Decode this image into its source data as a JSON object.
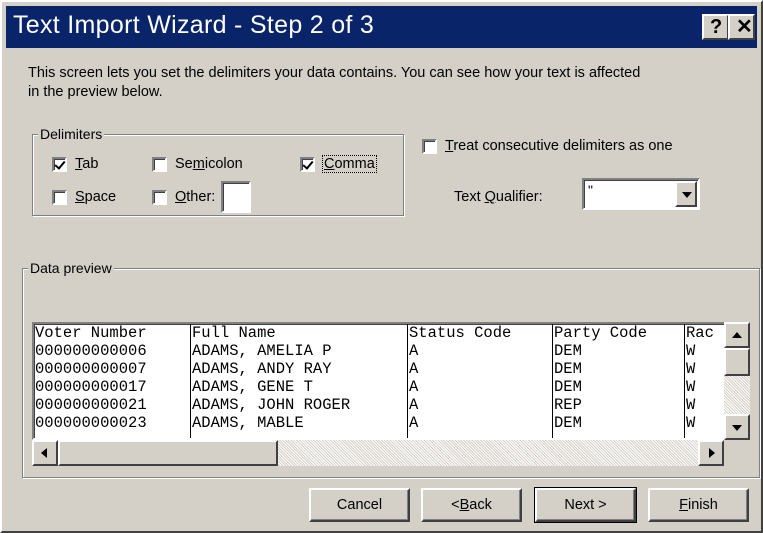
{
  "window": {
    "title": "Text Import Wizard - Step 2 of 3",
    "help_button": "?",
    "close_button": "✕"
  },
  "intro_text": "This screen lets you set the delimiters your data contains.  You can see how your text is affected in the preview below.",
  "delimiters": {
    "group_label": "Delimiters",
    "tab": {
      "pre": "",
      "key": "T",
      "post": "ab",
      "checked": true
    },
    "semicolon": {
      "pre": "Se",
      "key": "m",
      "post": "icolon",
      "checked": false
    },
    "comma": {
      "pre": "",
      "key": "C",
      "post": "omma",
      "checked": true
    },
    "space": {
      "pre": "",
      "key": "S",
      "post": "pace",
      "checked": false
    },
    "other": {
      "pre": "",
      "key": "O",
      "post": "ther:",
      "checked": false,
      "value": ""
    }
  },
  "consecutive": {
    "pre": "",
    "key": "T",
    "post": "reat consecutive delimiters as one",
    "checked": false
  },
  "text_qualifier": {
    "pre": "Text ",
    "key": "Q",
    "post": "ualifier:",
    "value": "\""
  },
  "preview": {
    "group_label": "Data preview",
    "columns": [
      {
        "header": "Voter Number",
        "rows": [
          "000000000006",
          "000000000007",
          "000000000017",
          "000000000021",
          "000000000023"
        ]
      },
      {
        "header": "Full Name",
        "rows": [
          "ADAMS, AMELIA P",
          "ADAMS, ANDY RAY",
          "ADAMS, GENE T",
          "ADAMS, JOHN ROGER",
          "ADAMS, MABLE"
        ]
      },
      {
        "header": "Status Code",
        "rows": [
          "A",
          "A",
          "A",
          "A",
          "A"
        ]
      },
      {
        "header": "Party Code",
        "rows": [
          "DEM",
          "DEM",
          "DEM",
          "REP",
          "DEM"
        ]
      },
      {
        "header": "Rac",
        "rows": [
          "W",
          "W",
          "W",
          "W",
          "W"
        ]
      }
    ]
  },
  "buttons": {
    "cancel": {
      "pre": "Cancel",
      "key": "",
      "post": ""
    },
    "back": {
      "pre": "< ",
      "key": "B",
      "post": "ack"
    },
    "next": {
      "pre": "Next >",
      "key": "",
      "post": ""
    },
    "finish": {
      "pre": "",
      "key": "F",
      "post": "inish"
    }
  }
}
